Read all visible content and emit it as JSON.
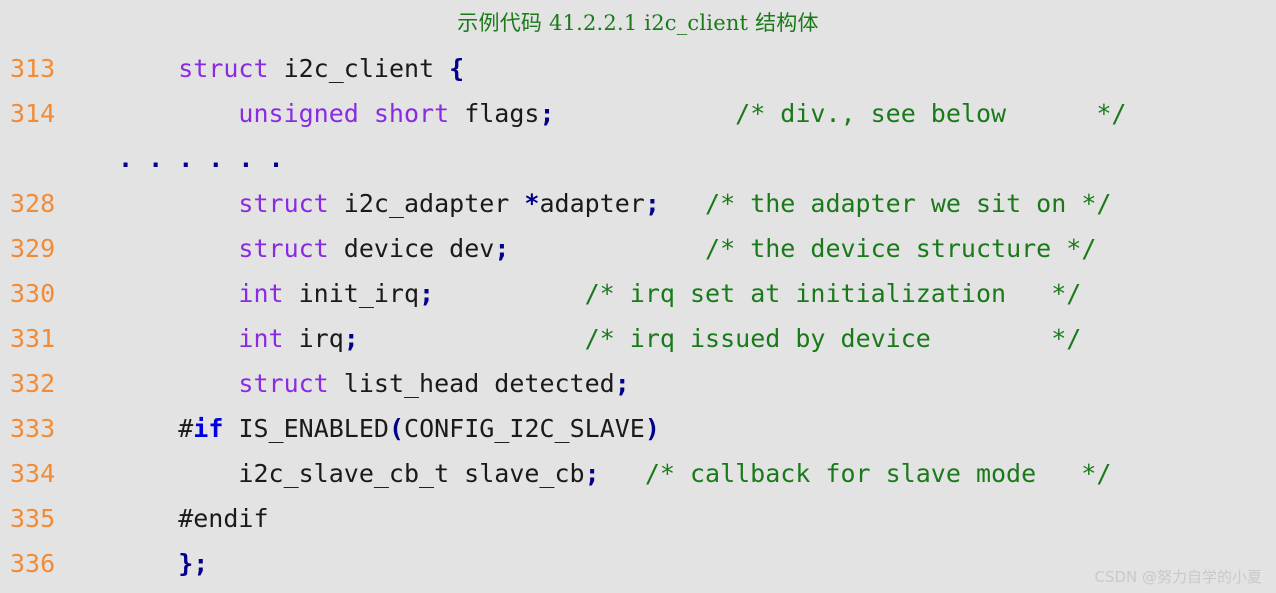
{
  "figure": {
    "title": "示例代码 41.2.2.1 i2c_client 结构体",
    "title_color": "#1a7a1a",
    "background_color": "#e3e3e3",
    "language": "c"
  },
  "colors": {
    "line_number": "#f28b35",
    "keyword": "#8a2be2",
    "preprocessor_keyword": "#0000e0",
    "identifier": "#1a1a1a",
    "punctuation": "#00008b",
    "comment": "#1a7a1a",
    "watermark": "#c9c9c9"
  },
  "code": {
    "lines": [
      {
        "number": "313",
        "tokens": [
          {
            "t": "    ",
            "c": "id"
          },
          {
            "t": "struct",
            "c": "kw"
          },
          {
            "t": " i2c_client ",
            "c": "id"
          },
          {
            "t": "{",
            "c": "punc"
          }
        ]
      },
      {
        "number": "314",
        "tokens": [
          {
            "t": "        ",
            "c": "id"
          },
          {
            "t": "unsigned short",
            "c": "kw"
          },
          {
            "t": " flags",
            "c": "id"
          },
          {
            "t": ";",
            "c": "punc"
          },
          {
            "t": "            ",
            "c": "id"
          },
          {
            "t": "/* div., see below      */",
            "c": "cmt"
          }
        ]
      },
      {
        "number": "",
        "is_ellipsis": true,
        "tokens": [
          {
            "t": ". . . . . .",
            "c": "dots"
          }
        ]
      },
      {
        "number": "328",
        "tokens": [
          {
            "t": "        ",
            "c": "id"
          },
          {
            "t": "struct",
            "c": "kw"
          },
          {
            "t": " i2c_adapter ",
            "c": "id"
          },
          {
            "t": "*",
            "c": "punc"
          },
          {
            "t": "adapter",
            "c": "id"
          },
          {
            "t": ";",
            "c": "punc"
          },
          {
            "t": "   ",
            "c": "id"
          },
          {
            "t": "/* the adapter we sit on */",
            "c": "cmt"
          }
        ]
      },
      {
        "number": "329",
        "tokens": [
          {
            "t": "        ",
            "c": "id"
          },
          {
            "t": "struct",
            "c": "kw"
          },
          {
            "t": " device dev",
            "c": "id"
          },
          {
            "t": ";",
            "c": "punc"
          },
          {
            "t": "             ",
            "c": "id"
          },
          {
            "t": "/* the device structure */",
            "c": "cmt"
          }
        ]
      },
      {
        "number": "330",
        "tokens": [
          {
            "t": "        ",
            "c": "id"
          },
          {
            "t": "int",
            "c": "kw"
          },
          {
            "t": " init_irq",
            "c": "id"
          },
          {
            "t": ";",
            "c": "punc"
          },
          {
            "t": "          ",
            "c": "id"
          },
          {
            "t": "/* irq set at initialization   */",
            "c": "cmt"
          }
        ]
      },
      {
        "number": "331",
        "tokens": [
          {
            "t": "        ",
            "c": "id"
          },
          {
            "t": "int",
            "c": "kw"
          },
          {
            "t": " irq",
            "c": "id"
          },
          {
            "t": ";",
            "c": "punc"
          },
          {
            "t": "               ",
            "c": "id"
          },
          {
            "t": "/* irq issued by device        */",
            "c": "cmt"
          }
        ]
      },
      {
        "number": "332",
        "tokens": [
          {
            "t": "        ",
            "c": "id"
          },
          {
            "t": "struct",
            "c": "kw"
          },
          {
            "t": " list_head detected",
            "c": "id"
          },
          {
            "t": ";",
            "c": "punc"
          }
        ]
      },
      {
        "number": "333",
        "tokens": [
          {
            "t": "    ",
            "c": "id"
          },
          {
            "t": "#",
            "c": "hash"
          },
          {
            "t": "if",
            "c": "pre"
          },
          {
            "t": " IS_ENABLED",
            "c": "id"
          },
          {
            "t": "(",
            "c": "punc"
          },
          {
            "t": "CONFIG_I2C_SLAVE",
            "c": "id"
          },
          {
            "t": ")",
            "c": "punc"
          }
        ]
      },
      {
        "number": "334",
        "tokens": [
          {
            "t": "        i2c_slave_cb_t slave_cb",
            "c": "id"
          },
          {
            "t": ";",
            "c": "punc"
          },
          {
            "t": "   ",
            "c": "id"
          },
          {
            "t": "/* callback for slave mode   */",
            "c": "cmt"
          }
        ]
      },
      {
        "number": "335",
        "tokens": [
          {
            "t": "    #endif",
            "c": "id"
          }
        ]
      },
      {
        "number": "336",
        "tokens": [
          {
            "t": "    ",
            "c": "id"
          },
          {
            "t": "};",
            "c": "punc"
          }
        ]
      }
    ]
  },
  "watermark": {
    "text": "CSDN @努力自学的小夏"
  }
}
